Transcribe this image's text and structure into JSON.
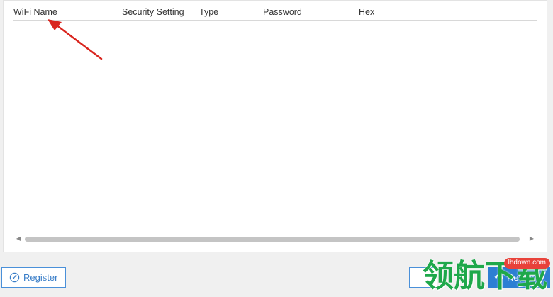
{
  "table": {
    "columns": [
      {
        "label": "WiFi Name"
      },
      {
        "label": "Security Setting"
      },
      {
        "label": "Type"
      },
      {
        "label": "Password"
      },
      {
        "label": "Hex"
      }
    ],
    "rows": []
  },
  "scrollbar": {
    "left_arrow": "◀",
    "right_arrow": "▶"
  },
  "footer": {
    "register_label": "Register",
    "refresh_label": "Refresh"
  },
  "watermark": {
    "text": "领航下载",
    "badge": "lhdown.com"
  },
  "colors": {
    "accent": "#2d7fd3",
    "arrow": "#d9251e",
    "watermark": "#1ea84a"
  },
  "icons": {
    "register": "register-icon",
    "refresh": "refresh-icon",
    "annotation": "red-arrow-annotation"
  }
}
